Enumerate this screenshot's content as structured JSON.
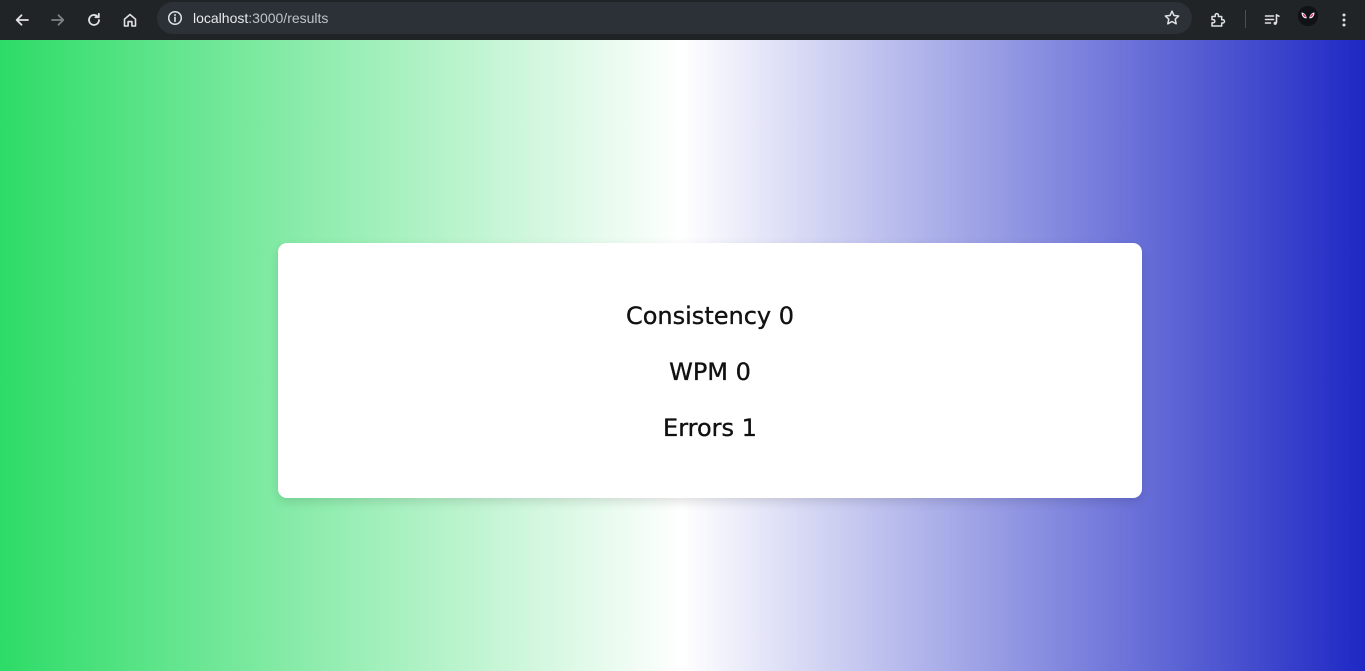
{
  "browser": {
    "url_host": "localhost",
    "url_path": ":3000/results"
  },
  "icons": {
    "back": "arrow-left-icon",
    "forward": "arrow-right-icon",
    "reload": "reload-icon",
    "home": "home-icon",
    "site_info": "info-icon",
    "bookmark": "star-icon",
    "extensions": "puzzle-icon",
    "reading_list": "reading-list-icon",
    "profile": "avatar",
    "menu": "kebab-menu-icon"
  },
  "colors": {
    "gradient_start": "#2ddc67",
    "gradient_mid": "#ffffff",
    "gradient_end": "#1e28c4",
    "card_background": "#ffffff"
  },
  "results": {
    "consistency": "Consistency 0",
    "wpm": "WPM 0",
    "errors": "Errors 1"
  }
}
